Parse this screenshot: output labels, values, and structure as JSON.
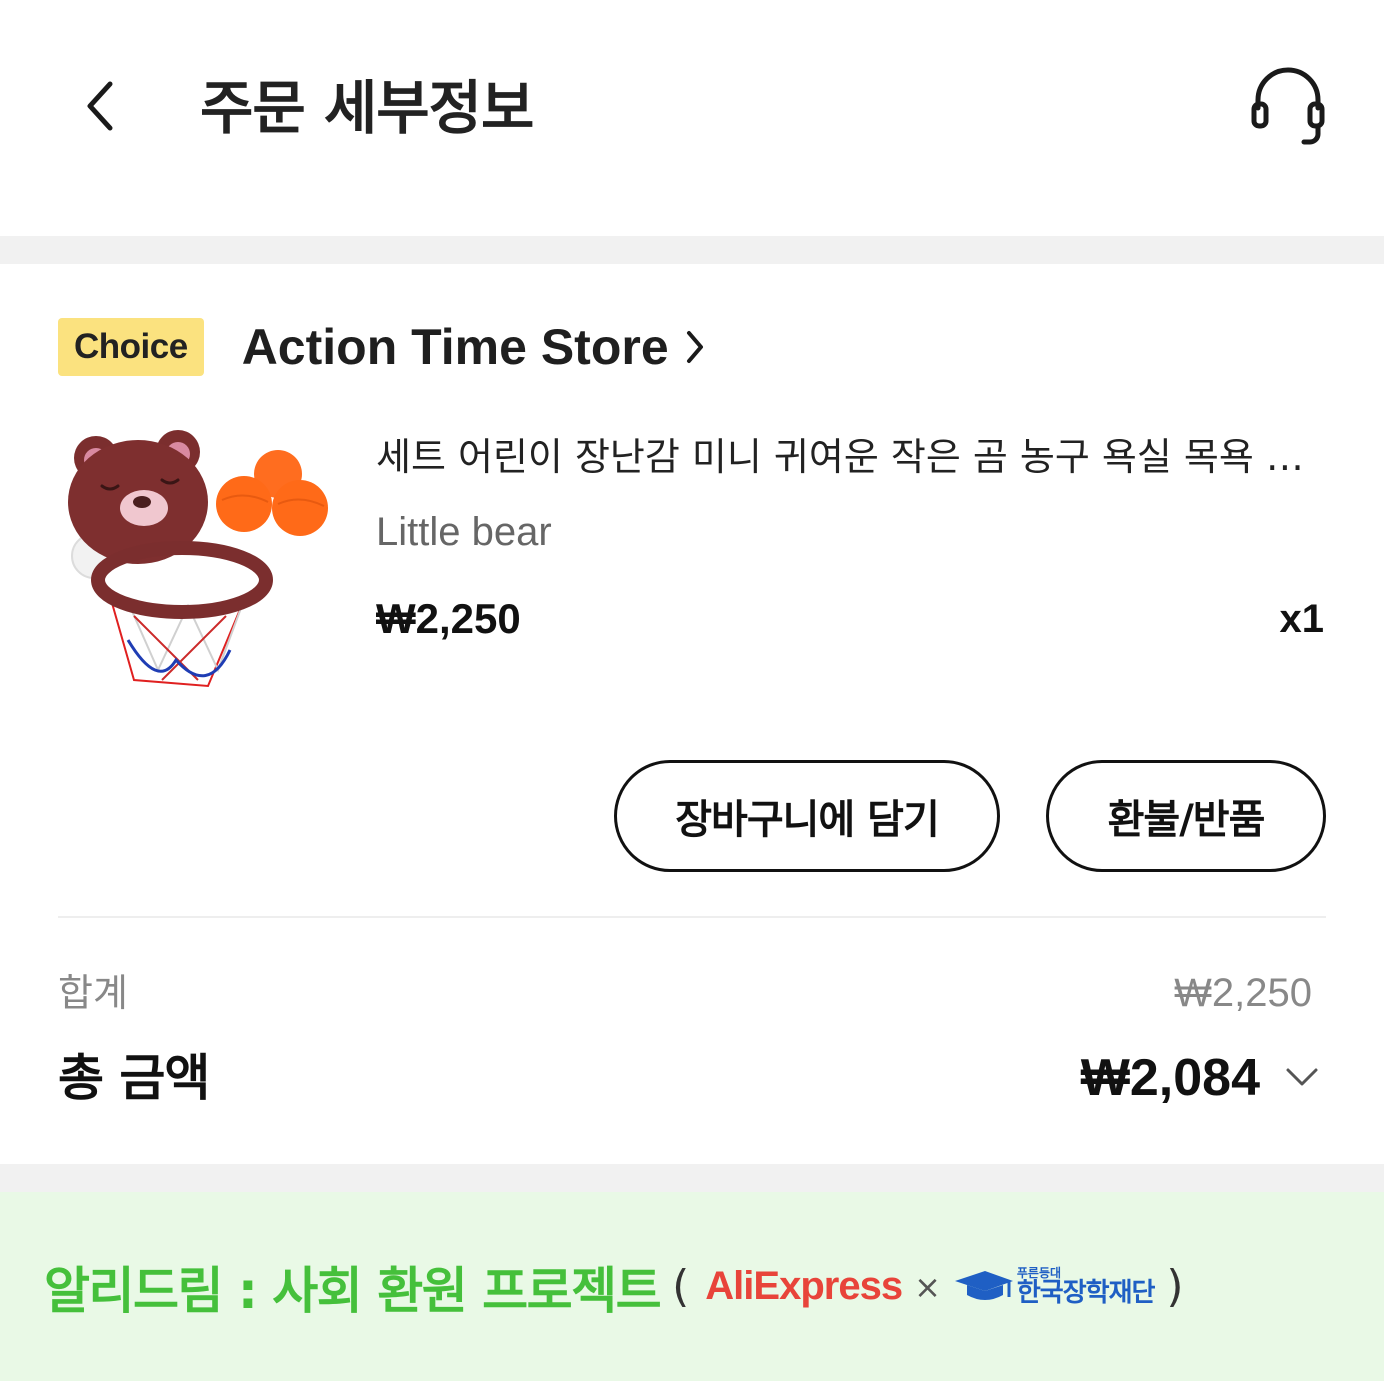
{
  "header": {
    "title": "주문 세부정보",
    "back_icon": "chevron-left-icon",
    "support_icon": "headset-icon"
  },
  "store": {
    "badge": "Choice",
    "badge_color": "#fbe27f",
    "name": "Action Time Store",
    "chevron_icon": "chevron-right-icon"
  },
  "product": {
    "image_icon": "bear-basketball-hoop-toy-image",
    "title": "세트 어린이 장난감 미니 귀여운 작은 곰 농구 욕실 목욕 장난감",
    "variant": "Little bear",
    "price": "₩2,250",
    "quantity": "x1"
  },
  "actions": {
    "add_to_cart": "장바구니에 담기",
    "refund": "환불/반품"
  },
  "summary": {
    "subtotal_label": "합계",
    "subtotal_value": "₩2,250",
    "total_label": "총 금액",
    "total_value": "₩2,084",
    "expand_icon": "chevron-down-icon"
  },
  "promo": {
    "headline": "알리드림 : 사회 환원 프로젝트",
    "paren_open": "(",
    "aliexpress_logo": "AliExpress",
    "times": "×",
    "foundation_small": "푸른등대",
    "foundation_name": "한국장학재단",
    "paren_close": ")",
    "headline_color": "#45c03b",
    "background_color": "#e9f9e6"
  }
}
